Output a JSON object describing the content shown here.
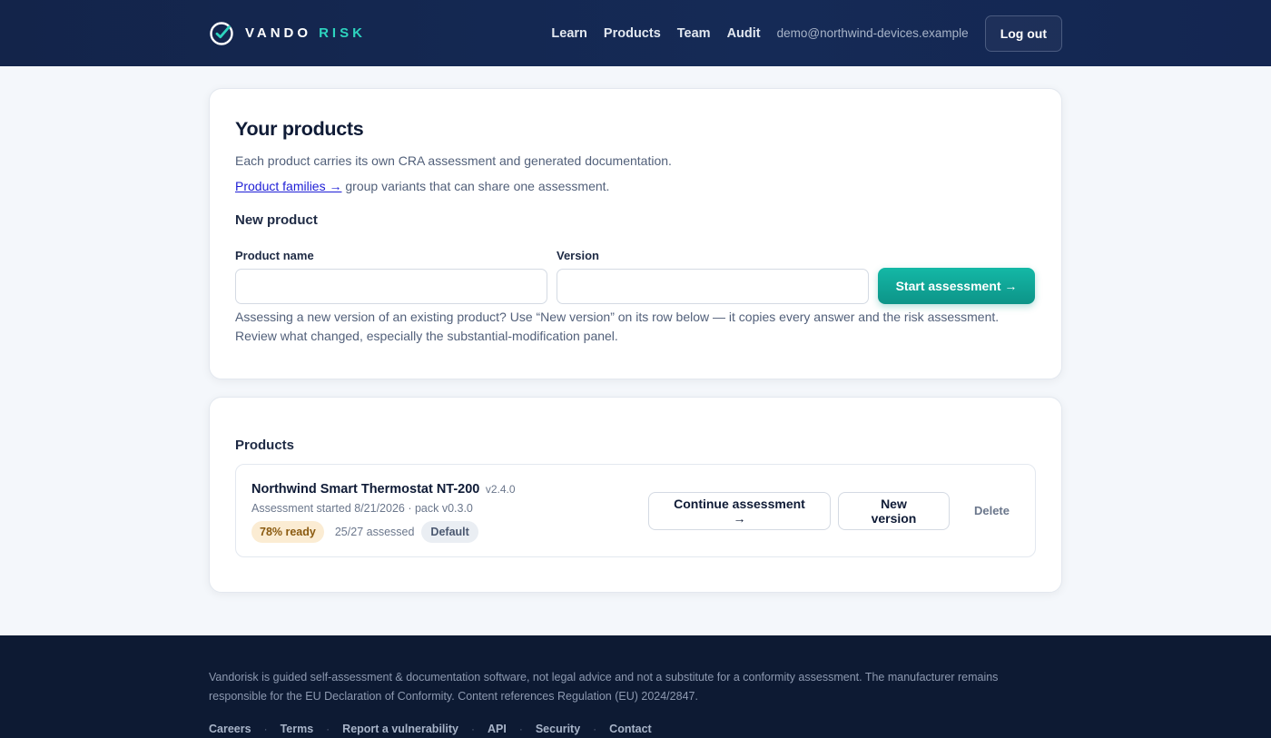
{
  "header": {
    "brand_primary": "VANDO",
    "brand_accent": "RISK",
    "logo_icon": "check-circle-icon",
    "nav": [
      "Learn",
      "Products",
      "Team",
      "Audit"
    ],
    "email": "demo@northwind-devices.example",
    "logout_label": "Log out"
  },
  "intro": {
    "title": "Your products",
    "subtitle": "Each product carries its own CRA assessment and generated documentation.",
    "families_link": "Product families →",
    "families_text": " group variants that can share one assessment."
  },
  "new_product": {
    "heading": "New product",
    "name_label": "Product name",
    "name_value": "",
    "version_label": "Version",
    "version_value": "",
    "start_button": "Start assessment →",
    "hint_line1": "Assessing a new version of an existing product? Use “New version” on its row below — it copies every answer and the risk assessment.",
    "hint_line2": "Review what changed, especially the substantial-modification panel."
  },
  "products": {
    "heading": "Products",
    "items": [
      {
        "name": "Northwind Smart Thermostat NT-200",
        "version": "v2.4.0",
        "meta": "Assessment started 8/21/2026 · pack v0.3.0",
        "ready": "78% ready",
        "assessed": "25/27 assessed",
        "tag": "Default",
        "continue_label": "Continue assessment →",
        "new_version_label": "New version",
        "delete_label": "Delete"
      }
    ]
  },
  "footer": {
    "disclaimer_line1": "Vandorisk is guided self-assessment & documentation software, not legal advice and not a substitute for a conformity assessment. The manufacturer remains",
    "disclaimer_line2": "responsible for the EU Declaration of Conformity. Content references Regulation (EU) 2024/2847.",
    "links": [
      "Careers",
      "Terms",
      "Report a vulnerability",
      "API",
      "Security",
      "Contact"
    ],
    "separator": "·"
  },
  "colors": {
    "header_bg": "#13244a",
    "accent": "#14b8a6",
    "footer_bg": "#0d1a33",
    "ready_badge": "#fbecd3"
  }
}
